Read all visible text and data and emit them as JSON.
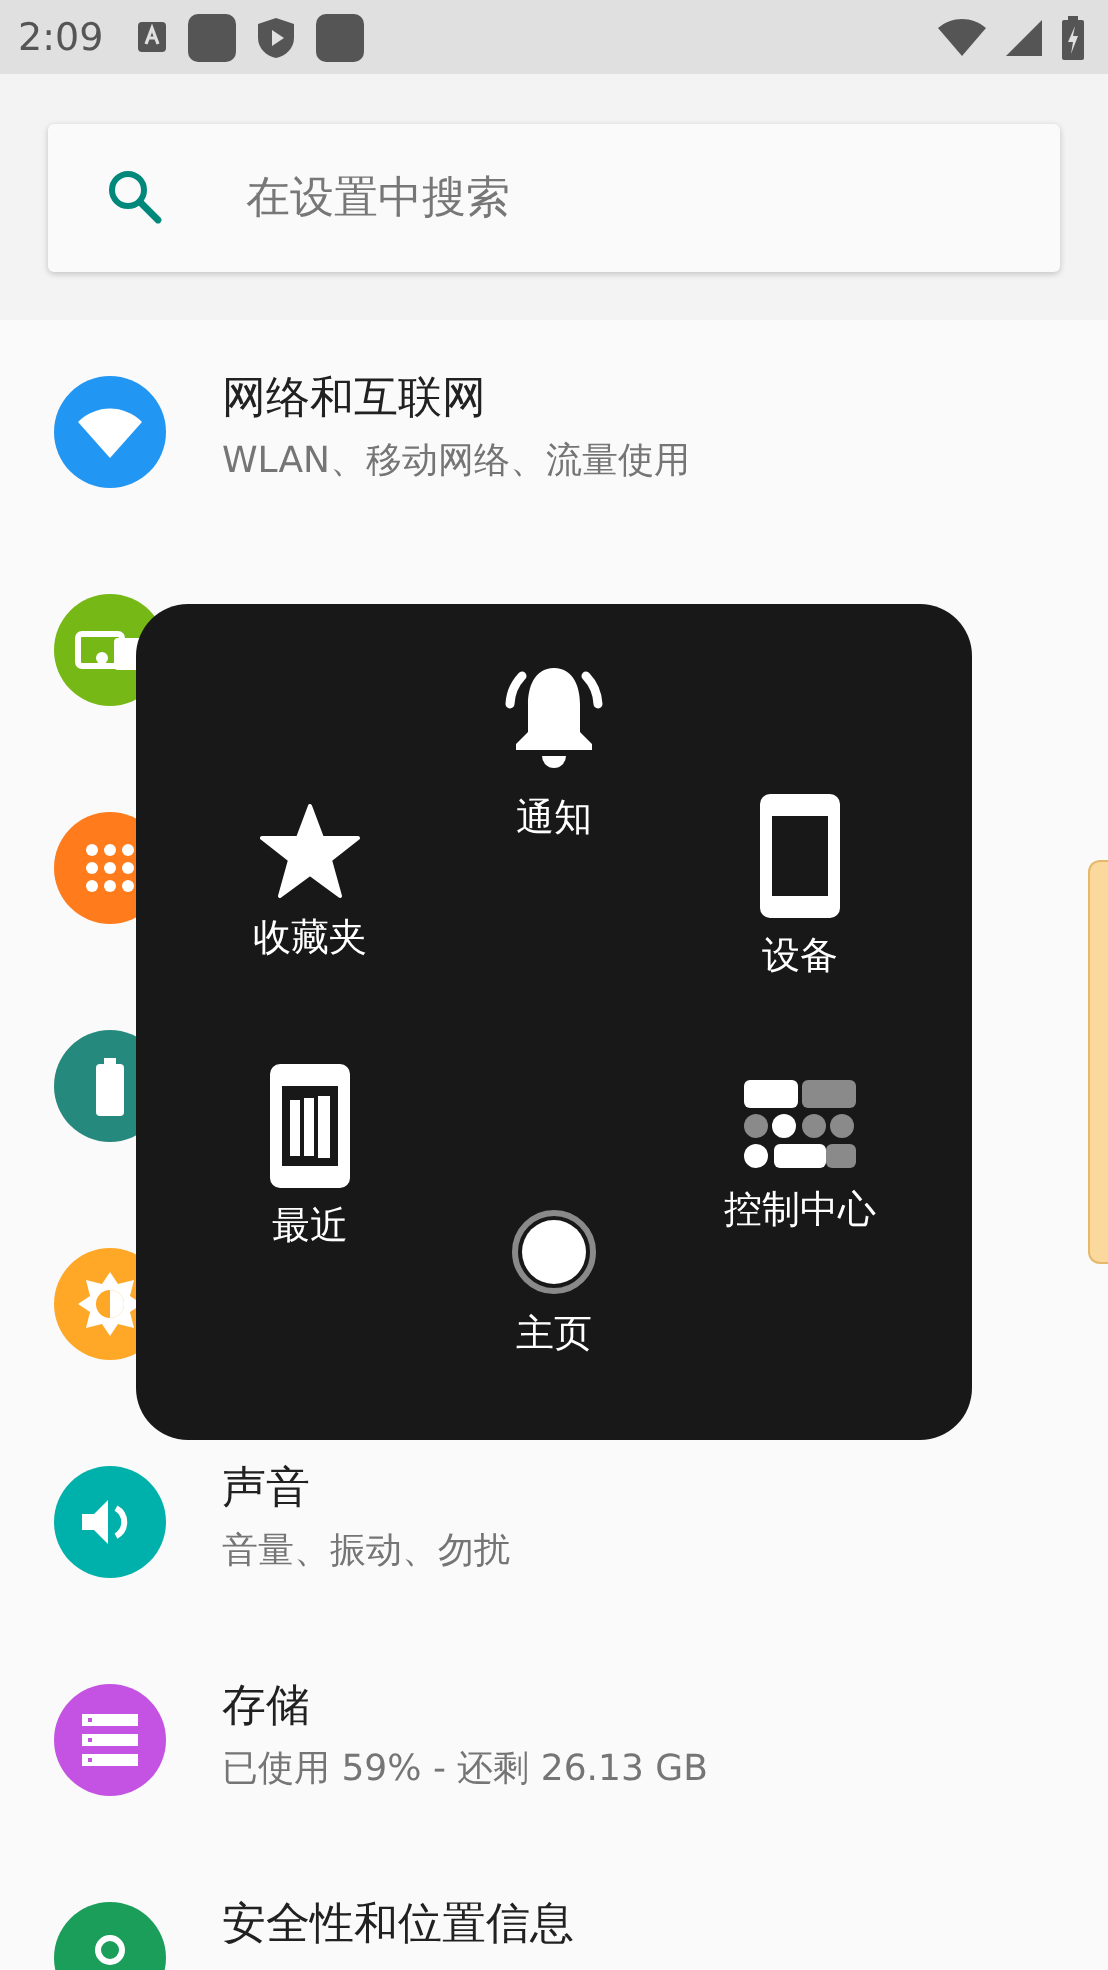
{
  "status_bar": {
    "time": "2:09"
  },
  "search": {
    "placeholder": "在设置中搜索"
  },
  "settings": [
    {
      "kind": "wifi",
      "color": "#2196f3",
      "title": "网络和互联网",
      "subtitle": "WLAN、移动网络、流量使用"
    },
    {
      "kind": "devices",
      "color": "#76b816"
    },
    {
      "kind": "apps",
      "color": "#ff7b1c"
    },
    {
      "kind": "battery",
      "color": "#26897d"
    },
    {
      "kind": "display",
      "color": "#ffa726"
    },
    {
      "kind": "sound",
      "color": "#00b1ab",
      "title": "声音",
      "subtitle": "音量、振动、勿扰"
    },
    {
      "kind": "storage",
      "color": "#c452e3",
      "title": "存储",
      "subtitle": "已使用 59% - 还剩 26.13 GB"
    },
    {
      "kind": "lock",
      "color": "#1b9e5a",
      "title": "安全性和位置信息"
    }
  ],
  "menu": {
    "items": [
      {
        "kind": "bell",
        "label": "通知"
      },
      {
        "kind": "star",
        "label": "收藏夹"
      },
      {
        "kind": "device",
        "label": "设备"
      },
      {
        "kind": "recent",
        "label": "最近"
      },
      {
        "kind": "control",
        "label": "控制中心"
      },
      {
        "kind": "home",
        "label": "主页"
      }
    ]
  }
}
